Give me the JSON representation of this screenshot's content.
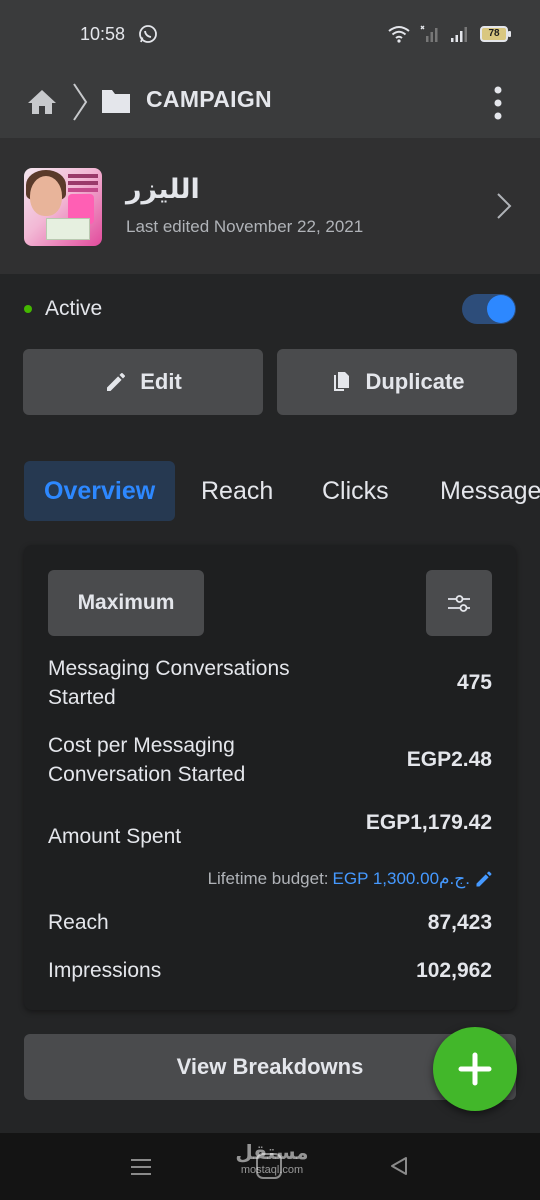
{
  "status_bar": {
    "time": "10:58",
    "battery": "78"
  },
  "app_bar": {
    "title": "CAMPAIGN"
  },
  "campaign": {
    "name": "الليزر",
    "last_edited": "Last edited November 22, 2021",
    "status": "Active",
    "active": true
  },
  "actions": {
    "edit": "Edit",
    "duplicate": "Duplicate"
  },
  "tabs": [
    {
      "label": "Overview",
      "active": true
    },
    {
      "label": "Reach",
      "active": false
    },
    {
      "label": "Clicks",
      "active": false
    },
    {
      "label": "Messages",
      "active": false
    }
  ],
  "overview": {
    "date_range_button": "Maximum",
    "metrics": [
      {
        "label": "Messaging Conversations Started",
        "value": "475"
      },
      {
        "label": "Cost per Messaging Conversation Started",
        "value": "EGP2.48"
      },
      {
        "label": "Amount Spent",
        "value": "EGP1,179.42"
      },
      {
        "label": "Reach",
        "value": "87,423"
      },
      {
        "label": "Impressions",
        "value": "102,962"
      }
    ],
    "budget_label": "Lifetime budget:",
    "budget_value": "EGP 1,300.00ج.م."
  },
  "view_breakdowns": "View Breakdowns",
  "watermark": {
    "arabic": "مستقل",
    "latin": "mostaql.com"
  },
  "colors": {
    "accent": "#2d88ff",
    "fab": "#42b72a",
    "active_dot": "#44b700",
    "background": "#242526"
  }
}
